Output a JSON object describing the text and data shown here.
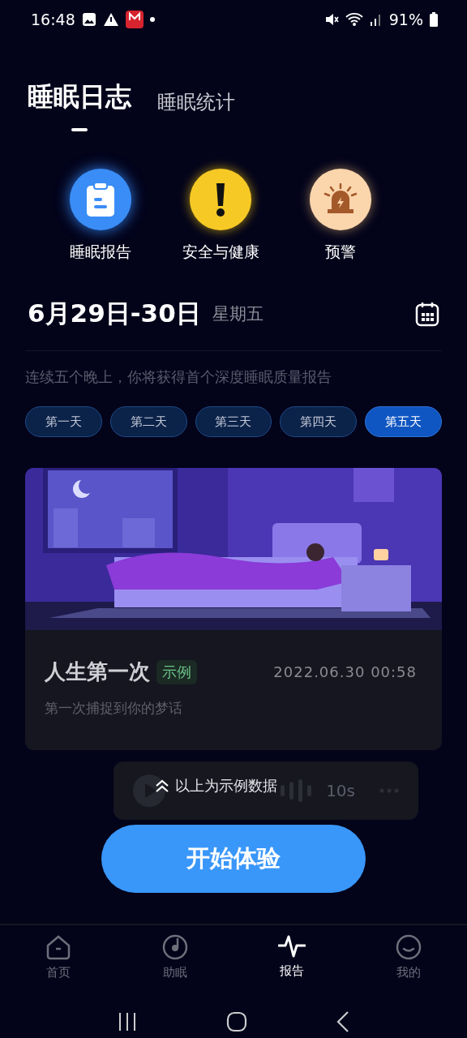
{
  "status_bar": {
    "time": "16:48",
    "battery": "91%"
  },
  "tabs": [
    {
      "label": "睡眠日志",
      "selected": true
    },
    {
      "label": "睡眠统计",
      "selected": false
    }
  ],
  "shortcuts": [
    {
      "label": "睡眠报告",
      "kind": "report"
    },
    {
      "label": "安全与健康",
      "kind": "safety"
    },
    {
      "label": "预警",
      "kind": "alarm"
    }
  ],
  "date": {
    "range": "6月29日-30日",
    "weekday": "星期五"
  },
  "hint": "连续五个晚上，你将获得首个深度睡眠质量报告",
  "days": [
    {
      "label": "第一天",
      "selected": false
    },
    {
      "label": "第二天",
      "selected": false
    },
    {
      "label": "第三天",
      "selected": false
    },
    {
      "label": "第四天",
      "selected": false
    },
    {
      "label": "第五天",
      "selected": true
    }
  ],
  "record": {
    "title": "人生第一次",
    "tag": "示例",
    "time": "2022.06.30 00:58",
    "subtitle": "第一次捕捉到你的梦话",
    "duration": "10s"
  },
  "sample_note": "以上为示例数据",
  "start_button": "开始体验",
  "nav": [
    {
      "label": "首页",
      "kind": "home",
      "selected": false
    },
    {
      "label": "助眠",
      "kind": "sleep",
      "selected": false
    },
    {
      "label": "报告",
      "kind": "report",
      "selected": true
    },
    {
      "label": "我的",
      "kind": "me",
      "selected": false
    }
  ]
}
